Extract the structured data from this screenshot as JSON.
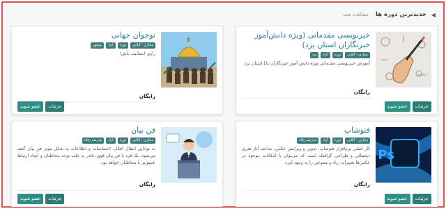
{
  "header": {
    "title": "جدیدترین دوره ها",
    "see_all": "مشاهده همه"
  },
  "courses": [
    {
      "title": "خبرنویسی مقدماتی (ویژه دانش‌آموز خبرنگاران استان یزد)",
      "tags": [
        "مجازی - آنلاین",
        "دوره",
        "آزاد",
        "یزد"
      ],
      "desc": "آموزش خبرنویسی مقدماتی ویژه دانش آموز خبرنگاران پانا استان یزد.",
      "price": "رایگان",
      "enroll": "عضو شوید",
      "details": "جزئیات",
      "thumb_icon": "hand-writing-icon"
    },
    {
      "title": "نوجوان جهانی",
      "tags": [
        "مجازی - آنلاین",
        "دوره",
        "آزاد",
        "بوشهر"
      ],
      "desc": "راوی انسانیت باش!",
      "price": "رایگان",
      "enroll": "عضو شوید",
      "details": "جزئیات",
      "thumb_icon": "mosque-people-icon"
    },
    {
      "title": "فتوشاپ",
      "tags": [
        "مجازی - آنلاین",
        "دوره",
        "آزاد",
        "مدرسه رفاه"
      ],
      "desc": "کار اصلی نرم‌افزار فتوشاپ، تدوین و ویرایش عکس، ساخت آثار هنری دیجیتالی و طراحی گرافیک است که می‌توان با امکانات موجود در عکس‌ها تغییرات زیاد و متنوعی را به وجود آورد.",
      "price": "رایگان",
      "enroll": "عضو شوید",
      "details": "جزئیات",
      "thumb_icon": "photoshop-logo-icon"
    },
    {
      "title": "فن بیان",
      "tags": [
        "مجازی - آنلاین",
        "دوره",
        "آزاد",
        "مدرسه رفاه"
      ],
      "desc": "به توانایی انتقال افکار، احساسات و اطلاعات به شکل موثر فن بیان گفته می‌شود. یک فرد با فن بیان قوی، قادر به جلب توجه مخاطبان و ایجاد ارتباط عمیق‌تر با مخاطبان خواهد بود.",
      "price": "رایگان",
      "enroll": "عضو شوید",
      "details": "جزئیات",
      "thumb_icon": "speaker-podium-icon"
    }
  ]
}
